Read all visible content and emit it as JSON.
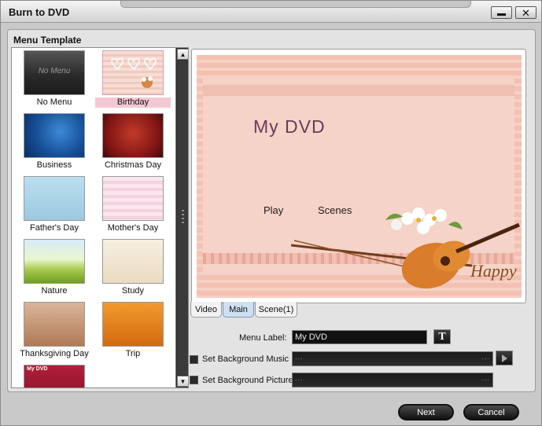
{
  "window": {
    "title": "Burn to DVD"
  },
  "panel": {
    "title": "Menu Template"
  },
  "templates": [
    {
      "label": "No Menu",
      "thumb_text": "No Menu"
    },
    {
      "label": "Birthday",
      "selected": true
    },
    {
      "label": "Business"
    },
    {
      "label": "Christmas Day"
    },
    {
      "label": "Father's Day"
    },
    {
      "label": "Mother's Day"
    },
    {
      "label": "Nature"
    },
    {
      "label": "Study"
    },
    {
      "label": "Thanksgiving Day"
    },
    {
      "label": "Trip"
    },
    {
      "label": "",
      "thumb_text": "My DVD"
    }
  ],
  "preview": {
    "title": "My DVD",
    "items": [
      "Play",
      "Scenes"
    ],
    "logo_text": "Happy"
  },
  "tabs": [
    {
      "label": "Video"
    },
    {
      "label": "Main",
      "active": true
    },
    {
      "label": "Scene(1)"
    }
  ],
  "settings": {
    "menu_label_text": "Menu Label:",
    "menu_label_value": "My DVD",
    "bg_music_text": "Set Background Music",
    "bg_picture_text": "Set Background Picture",
    "bg_music_checked": false,
    "bg_picture_checked": false
  },
  "buttons": {
    "next": "Next",
    "cancel": "Cancel"
  }
}
